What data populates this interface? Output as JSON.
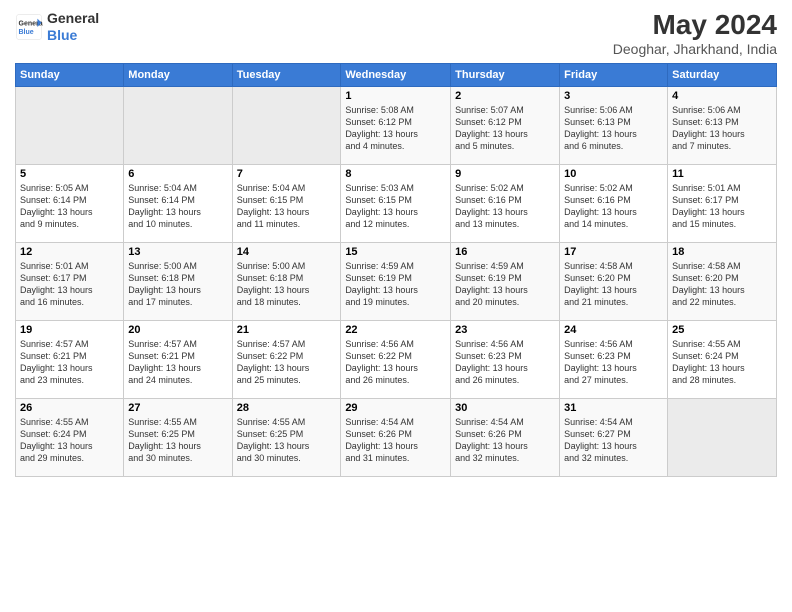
{
  "logo": {
    "line1": "General",
    "line2": "Blue"
  },
  "title": "May 2024",
  "subtitle": "Deoghar, Jharkhand, India",
  "days_header": [
    "Sunday",
    "Monday",
    "Tuesday",
    "Wednesday",
    "Thursday",
    "Friday",
    "Saturday"
  ],
  "weeks": [
    [
      {
        "num": "",
        "info": ""
      },
      {
        "num": "",
        "info": ""
      },
      {
        "num": "",
        "info": ""
      },
      {
        "num": "1",
        "info": "Sunrise: 5:08 AM\nSunset: 6:12 PM\nDaylight: 13 hours\nand 4 minutes."
      },
      {
        "num": "2",
        "info": "Sunrise: 5:07 AM\nSunset: 6:12 PM\nDaylight: 13 hours\nand 5 minutes."
      },
      {
        "num": "3",
        "info": "Sunrise: 5:06 AM\nSunset: 6:13 PM\nDaylight: 13 hours\nand 6 minutes."
      },
      {
        "num": "4",
        "info": "Sunrise: 5:06 AM\nSunset: 6:13 PM\nDaylight: 13 hours\nand 7 minutes."
      }
    ],
    [
      {
        "num": "5",
        "info": "Sunrise: 5:05 AM\nSunset: 6:14 PM\nDaylight: 13 hours\nand 9 minutes."
      },
      {
        "num": "6",
        "info": "Sunrise: 5:04 AM\nSunset: 6:14 PM\nDaylight: 13 hours\nand 10 minutes."
      },
      {
        "num": "7",
        "info": "Sunrise: 5:04 AM\nSunset: 6:15 PM\nDaylight: 13 hours\nand 11 minutes."
      },
      {
        "num": "8",
        "info": "Sunrise: 5:03 AM\nSunset: 6:15 PM\nDaylight: 13 hours\nand 12 minutes."
      },
      {
        "num": "9",
        "info": "Sunrise: 5:02 AM\nSunset: 6:16 PM\nDaylight: 13 hours\nand 13 minutes."
      },
      {
        "num": "10",
        "info": "Sunrise: 5:02 AM\nSunset: 6:16 PM\nDaylight: 13 hours\nand 14 minutes."
      },
      {
        "num": "11",
        "info": "Sunrise: 5:01 AM\nSunset: 6:17 PM\nDaylight: 13 hours\nand 15 minutes."
      }
    ],
    [
      {
        "num": "12",
        "info": "Sunrise: 5:01 AM\nSunset: 6:17 PM\nDaylight: 13 hours\nand 16 minutes."
      },
      {
        "num": "13",
        "info": "Sunrise: 5:00 AM\nSunset: 6:18 PM\nDaylight: 13 hours\nand 17 minutes."
      },
      {
        "num": "14",
        "info": "Sunrise: 5:00 AM\nSunset: 6:18 PM\nDaylight: 13 hours\nand 18 minutes."
      },
      {
        "num": "15",
        "info": "Sunrise: 4:59 AM\nSunset: 6:19 PM\nDaylight: 13 hours\nand 19 minutes."
      },
      {
        "num": "16",
        "info": "Sunrise: 4:59 AM\nSunset: 6:19 PM\nDaylight: 13 hours\nand 20 minutes."
      },
      {
        "num": "17",
        "info": "Sunrise: 4:58 AM\nSunset: 6:20 PM\nDaylight: 13 hours\nand 21 minutes."
      },
      {
        "num": "18",
        "info": "Sunrise: 4:58 AM\nSunset: 6:20 PM\nDaylight: 13 hours\nand 22 minutes."
      }
    ],
    [
      {
        "num": "19",
        "info": "Sunrise: 4:57 AM\nSunset: 6:21 PM\nDaylight: 13 hours\nand 23 minutes."
      },
      {
        "num": "20",
        "info": "Sunrise: 4:57 AM\nSunset: 6:21 PM\nDaylight: 13 hours\nand 24 minutes."
      },
      {
        "num": "21",
        "info": "Sunrise: 4:57 AM\nSunset: 6:22 PM\nDaylight: 13 hours\nand 25 minutes."
      },
      {
        "num": "22",
        "info": "Sunrise: 4:56 AM\nSunset: 6:22 PM\nDaylight: 13 hours\nand 26 minutes."
      },
      {
        "num": "23",
        "info": "Sunrise: 4:56 AM\nSunset: 6:23 PM\nDaylight: 13 hours\nand 26 minutes."
      },
      {
        "num": "24",
        "info": "Sunrise: 4:56 AM\nSunset: 6:23 PM\nDaylight: 13 hours\nand 27 minutes."
      },
      {
        "num": "25",
        "info": "Sunrise: 4:55 AM\nSunset: 6:24 PM\nDaylight: 13 hours\nand 28 minutes."
      }
    ],
    [
      {
        "num": "26",
        "info": "Sunrise: 4:55 AM\nSunset: 6:24 PM\nDaylight: 13 hours\nand 29 minutes."
      },
      {
        "num": "27",
        "info": "Sunrise: 4:55 AM\nSunset: 6:25 PM\nDaylight: 13 hours\nand 30 minutes."
      },
      {
        "num": "28",
        "info": "Sunrise: 4:55 AM\nSunset: 6:25 PM\nDaylight: 13 hours\nand 30 minutes."
      },
      {
        "num": "29",
        "info": "Sunrise: 4:54 AM\nSunset: 6:26 PM\nDaylight: 13 hours\nand 31 minutes."
      },
      {
        "num": "30",
        "info": "Sunrise: 4:54 AM\nSunset: 6:26 PM\nDaylight: 13 hours\nand 32 minutes."
      },
      {
        "num": "31",
        "info": "Sunrise: 4:54 AM\nSunset: 6:27 PM\nDaylight: 13 hours\nand 32 minutes."
      },
      {
        "num": "",
        "info": ""
      }
    ]
  ]
}
